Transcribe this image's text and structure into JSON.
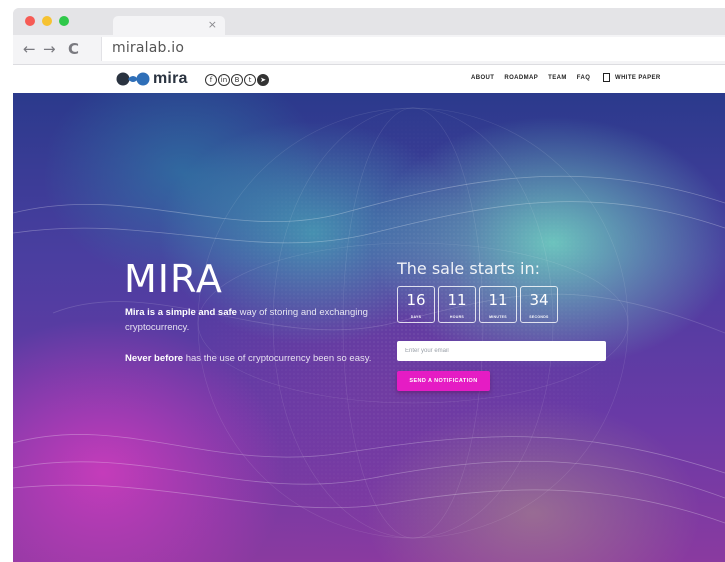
{
  "browser": {
    "tab_close": "×",
    "back_icon": "←",
    "forward_icon": "→",
    "reload_icon": "C",
    "url": "miralab.io"
  },
  "nav": {
    "logo_text": "mira",
    "socials": [
      "f",
      "in",
      "B",
      "t",
      "➤"
    ],
    "menu": [
      "ABOUT",
      "ROADMAP",
      "TEAM",
      "FAQ"
    ],
    "white_paper": "WHITE PAPER"
  },
  "hero": {
    "title": "MIRA",
    "p1_bold": "Mira is a simple and safe",
    "p1_rest": " way of storing and exchanging cryptocurrency.",
    "p2_bold": "Never before",
    "p2_rest": " has the use of cryptocurrency been so easy."
  },
  "sale": {
    "title": "The sale starts in:",
    "countdown": [
      {
        "value": "16",
        "label": "DAYS"
      },
      {
        "value": "11",
        "label": "HOURS"
      },
      {
        "value": "11",
        "label": "MINUTES"
      },
      {
        "value": "34",
        "label": "SECONDS"
      }
    ],
    "email_placeholder": "Enter your email",
    "button": "SEND A NOTIFICATION"
  },
  "colors": {
    "accent": "#e51cc4",
    "logo_dark": "#2a3340",
    "logo_blue": "#2f6fb8"
  }
}
